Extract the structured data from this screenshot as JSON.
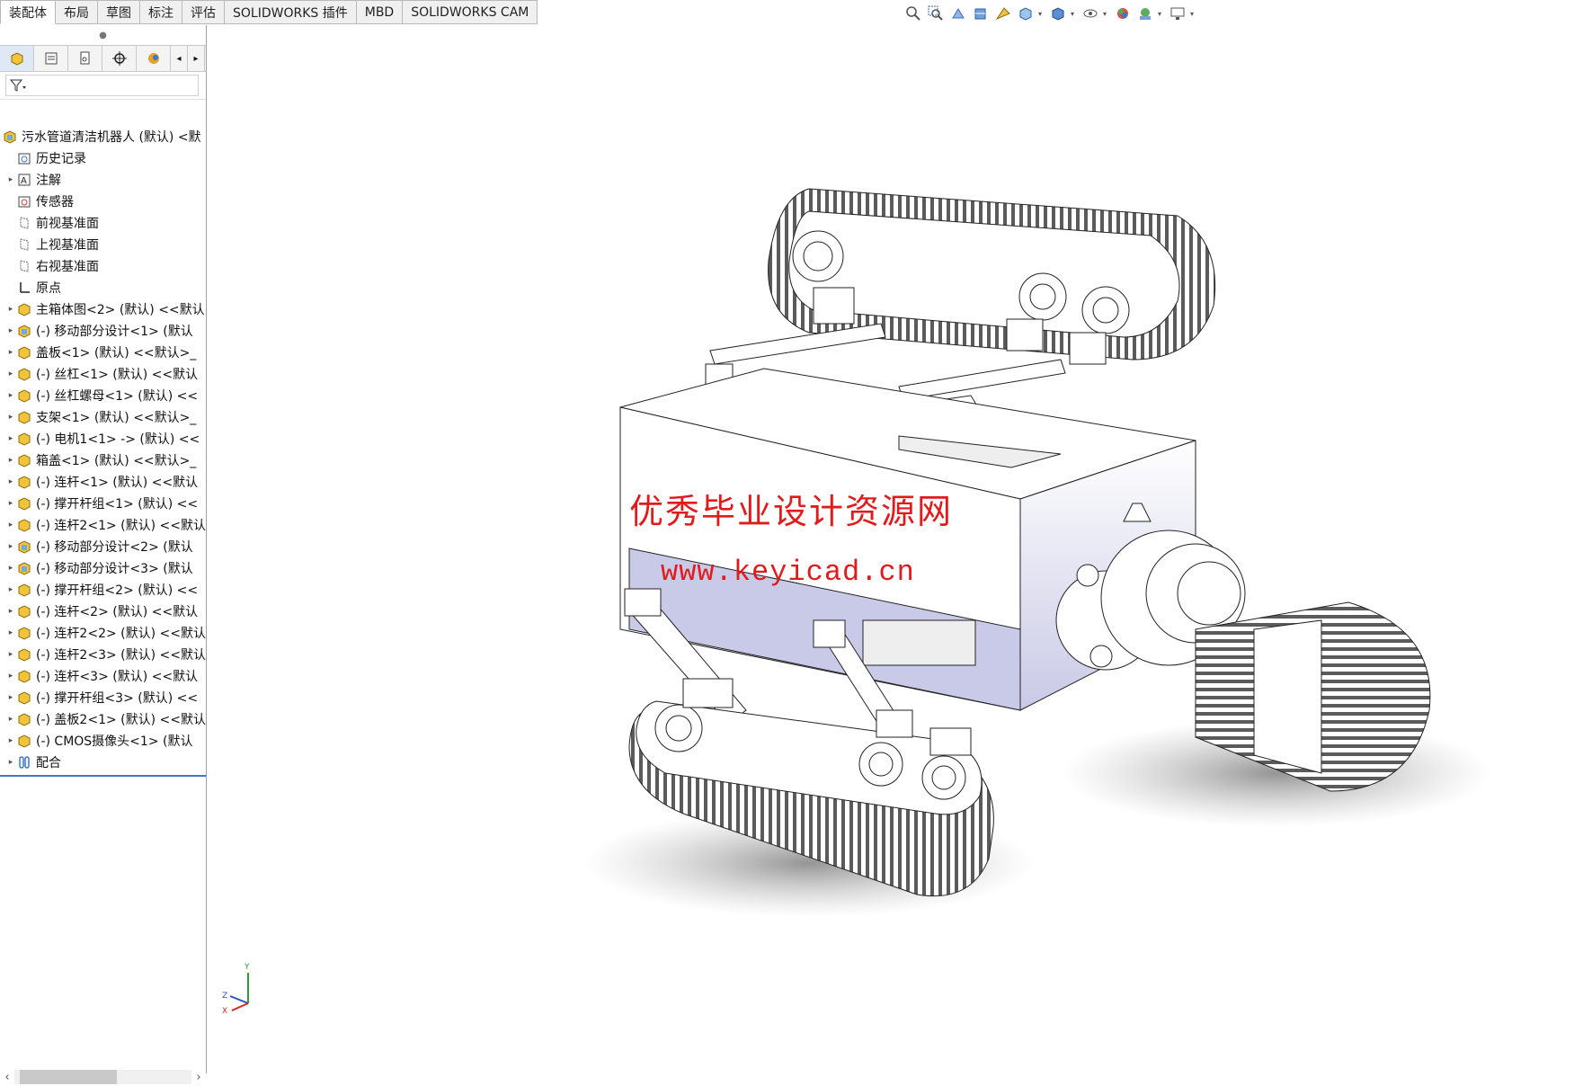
{
  "tabs": [
    "装配体",
    "布局",
    "草图",
    "标注",
    "评估",
    "SOLIDWORKS 插件",
    "MBD",
    "SOLIDWORKS CAM"
  ],
  "hud_icons": [
    "zoom-to-fit-icon",
    "zoom-area-icon",
    "previous-view-icon",
    "section-view-icon",
    "dynamic-annotation-icon",
    "view-orientation-icon",
    "display-style-icon",
    "hide-show-icon",
    "edit-appearance-icon",
    "apply-scene-icon",
    "view-settings-icon"
  ],
  "panel_tabs": [
    "featuremanager-icon",
    "propertymanager-icon",
    "configurationmanager-icon",
    "dimxpert-icon",
    "display-manager-icon"
  ],
  "tree": {
    "root": "污水管道清洁机器人 (默认) <默",
    "items": [
      {
        "label": "历史记录",
        "icon": "history",
        "exp": false
      },
      {
        "label": "注解",
        "icon": "annotation",
        "exp": true
      },
      {
        "label": "传感器",
        "icon": "sensor",
        "exp": false
      },
      {
        "label": "前视基准面",
        "icon": "plane",
        "exp": false
      },
      {
        "label": "上视基准面",
        "icon": "plane",
        "exp": false
      },
      {
        "label": "右视基准面",
        "icon": "plane",
        "exp": false
      },
      {
        "label": "原点",
        "icon": "origin",
        "exp": false
      },
      {
        "label": "主箱体图<2> (默认) <<默认",
        "icon": "part",
        "exp": true
      },
      {
        "label": "(-) 移动部分设计<1> (默认",
        "icon": "assembly",
        "exp": true
      },
      {
        "label": "盖板<1> (默认) <<默认>_",
        "icon": "part",
        "exp": true
      },
      {
        "label": "(-) 丝杠<1> (默认) <<默认",
        "icon": "part",
        "exp": true
      },
      {
        "label": "(-) 丝杠螺母<1> (默认) <<",
        "icon": "part",
        "exp": true
      },
      {
        "label": "支架<1> (默认) <<默认>_",
        "icon": "part",
        "exp": true
      },
      {
        "label": "(-) 电机1<1> -> (默认) <<",
        "icon": "part",
        "exp": true
      },
      {
        "label": "箱盖<1> (默认) <<默认>_",
        "icon": "part",
        "exp": true
      },
      {
        "label": "(-) 连杆<1> (默认) <<默认",
        "icon": "part",
        "exp": true
      },
      {
        "label": "(-) 撑开杆组<1> (默认) <<",
        "icon": "part",
        "exp": true
      },
      {
        "label": "(-) 连杆2<1> (默认) <<默认",
        "icon": "part",
        "exp": true
      },
      {
        "label": "(-) 移动部分设计<2> (默认",
        "icon": "assembly",
        "exp": true
      },
      {
        "label": "(-) 移动部分设计<3> (默认",
        "icon": "assembly",
        "exp": true
      },
      {
        "label": "(-) 撑开杆组<2> (默认) <<",
        "icon": "part",
        "exp": true
      },
      {
        "label": "(-) 连杆<2> (默认) <<默认",
        "icon": "part",
        "exp": true
      },
      {
        "label": "(-) 连杆2<2> (默认) <<默认",
        "icon": "part",
        "exp": true
      },
      {
        "label": "(-) 连杆2<3> (默认) <<默认",
        "icon": "part",
        "exp": true
      },
      {
        "label": "(-) 连杆<3> (默认) <<默认",
        "icon": "part",
        "exp": true
      },
      {
        "label": "(-) 撑开杆组<3> (默认) <<",
        "icon": "part",
        "exp": true
      },
      {
        "label": "(-) 盖板2<1> (默认) <<默认",
        "icon": "part",
        "exp": true
      },
      {
        "label": "(-) CMOS摄像头<1> (默认",
        "icon": "part",
        "exp": true
      },
      {
        "label": "配合",
        "icon": "mates",
        "exp": true
      }
    ]
  },
  "watermark": {
    "line1": "优秀毕业设计资源网",
    "line2": "www.keyicad.cn",
    "color": "#e11b1b"
  },
  "triad_labels": {
    "y": "Y",
    "x": "X",
    "z": "Z"
  }
}
